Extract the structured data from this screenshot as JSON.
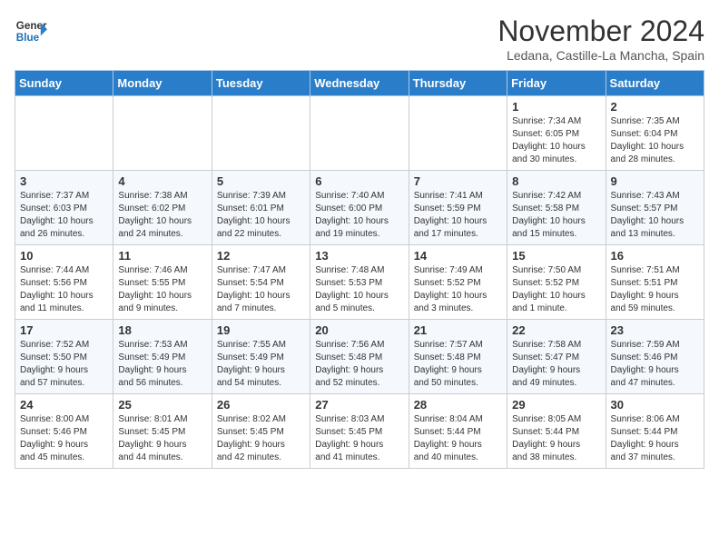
{
  "header": {
    "logo_line1": "General",
    "logo_line2": "Blue",
    "month": "November 2024",
    "location": "Ledana, Castille-La Mancha, Spain"
  },
  "weekdays": [
    "Sunday",
    "Monday",
    "Tuesday",
    "Wednesday",
    "Thursday",
    "Friday",
    "Saturday"
  ],
  "weeks": [
    [
      {
        "day": "",
        "info": ""
      },
      {
        "day": "",
        "info": ""
      },
      {
        "day": "",
        "info": ""
      },
      {
        "day": "",
        "info": ""
      },
      {
        "day": "",
        "info": ""
      },
      {
        "day": "1",
        "info": "Sunrise: 7:34 AM\nSunset: 6:05 PM\nDaylight: 10 hours\nand 30 minutes."
      },
      {
        "day": "2",
        "info": "Sunrise: 7:35 AM\nSunset: 6:04 PM\nDaylight: 10 hours\nand 28 minutes."
      }
    ],
    [
      {
        "day": "3",
        "info": "Sunrise: 7:37 AM\nSunset: 6:03 PM\nDaylight: 10 hours\nand 26 minutes."
      },
      {
        "day": "4",
        "info": "Sunrise: 7:38 AM\nSunset: 6:02 PM\nDaylight: 10 hours\nand 24 minutes."
      },
      {
        "day": "5",
        "info": "Sunrise: 7:39 AM\nSunset: 6:01 PM\nDaylight: 10 hours\nand 22 minutes."
      },
      {
        "day": "6",
        "info": "Sunrise: 7:40 AM\nSunset: 6:00 PM\nDaylight: 10 hours\nand 19 minutes."
      },
      {
        "day": "7",
        "info": "Sunrise: 7:41 AM\nSunset: 5:59 PM\nDaylight: 10 hours\nand 17 minutes."
      },
      {
        "day": "8",
        "info": "Sunrise: 7:42 AM\nSunset: 5:58 PM\nDaylight: 10 hours\nand 15 minutes."
      },
      {
        "day": "9",
        "info": "Sunrise: 7:43 AM\nSunset: 5:57 PM\nDaylight: 10 hours\nand 13 minutes."
      }
    ],
    [
      {
        "day": "10",
        "info": "Sunrise: 7:44 AM\nSunset: 5:56 PM\nDaylight: 10 hours\nand 11 minutes."
      },
      {
        "day": "11",
        "info": "Sunrise: 7:46 AM\nSunset: 5:55 PM\nDaylight: 10 hours\nand 9 minutes."
      },
      {
        "day": "12",
        "info": "Sunrise: 7:47 AM\nSunset: 5:54 PM\nDaylight: 10 hours\nand 7 minutes."
      },
      {
        "day": "13",
        "info": "Sunrise: 7:48 AM\nSunset: 5:53 PM\nDaylight: 10 hours\nand 5 minutes."
      },
      {
        "day": "14",
        "info": "Sunrise: 7:49 AM\nSunset: 5:52 PM\nDaylight: 10 hours\nand 3 minutes."
      },
      {
        "day": "15",
        "info": "Sunrise: 7:50 AM\nSunset: 5:52 PM\nDaylight: 10 hours\nand 1 minute."
      },
      {
        "day": "16",
        "info": "Sunrise: 7:51 AM\nSunset: 5:51 PM\nDaylight: 9 hours\nand 59 minutes."
      }
    ],
    [
      {
        "day": "17",
        "info": "Sunrise: 7:52 AM\nSunset: 5:50 PM\nDaylight: 9 hours\nand 57 minutes."
      },
      {
        "day": "18",
        "info": "Sunrise: 7:53 AM\nSunset: 5:49 PM\nDaylight: 9 hours\nand 56 minutes."
      },
      {
        "day": "19",
        "info": "Sunrise: 7:55 AM\nSunset: 5:49 PM\nDaylight: 9 hours\nand 54 minutes."
      },
      {
        "day": "20",
        "info": "Sunrise: 7:56 AM\nSunset: 5:48 PM\nDaylight: 9 hours\nand 52 minutes."
      },
      {
        "day": "21",
        "info": "Sunrise: 7:57 AM\nSunset: 5:48 PM\nDaylight: 9 hours\nand 50 minutes."
      },
      {
        "day": "22",
        "info": "Sunrise: 7:58 AM\nSunset: 5:47 PM\nDaylight: 9 hours\nand 49 minutes."
      },
      {
        "day": "23",
        "info": "Sunrise: 7:59 AM\nSunset: 5:46 PM\nDaylight: 9 hours\nand 47 minutes."
      }
    ],
    [
      {
        "day": "24",
        "info": "Sunrise: 8:00 AM\nSunset: 5:46 PM\nDaylight: 9 hours\nand 45 minutes."
      },
      {
        "day": "25",
        "info": "Sunrise: 8:01 AM\nSunset: 5:45 PM\nDaylight: 9 hours\nand 44 minutes."
      },
      {
        "day": "26",
        "info": "Sunrise: 8:02 AM\nSunset: 5:45 PM\nDaylight: 9 hours\nand 42 minutes."
      },
      {
        "day": "27",
        "info": "Sunrise: 8:03 AM\nSunset: 5:45 PM\nDaylight: 9 hours\nand 41 minutes."
      },
      {
        "day": "28",
        "info": "Sunrise: 8:04 AM\nSunset: 5:44 PM\nDaylight: 9 hours\nand 40 minutes."
      },
      {
        "day": "29",
        "info": "Sunrise: 8:05 AM\nSunset: 5:44 PM\nDaylight: 9 hours\nand 38 minutes."
      },
      {
        "day": "30",
        "info": "Sunrise: 8:06 AM\nSunset: 5:44 PM\nDaylight: 9 hours\nand 37 minutes."
      }
    ]
  ]
}
